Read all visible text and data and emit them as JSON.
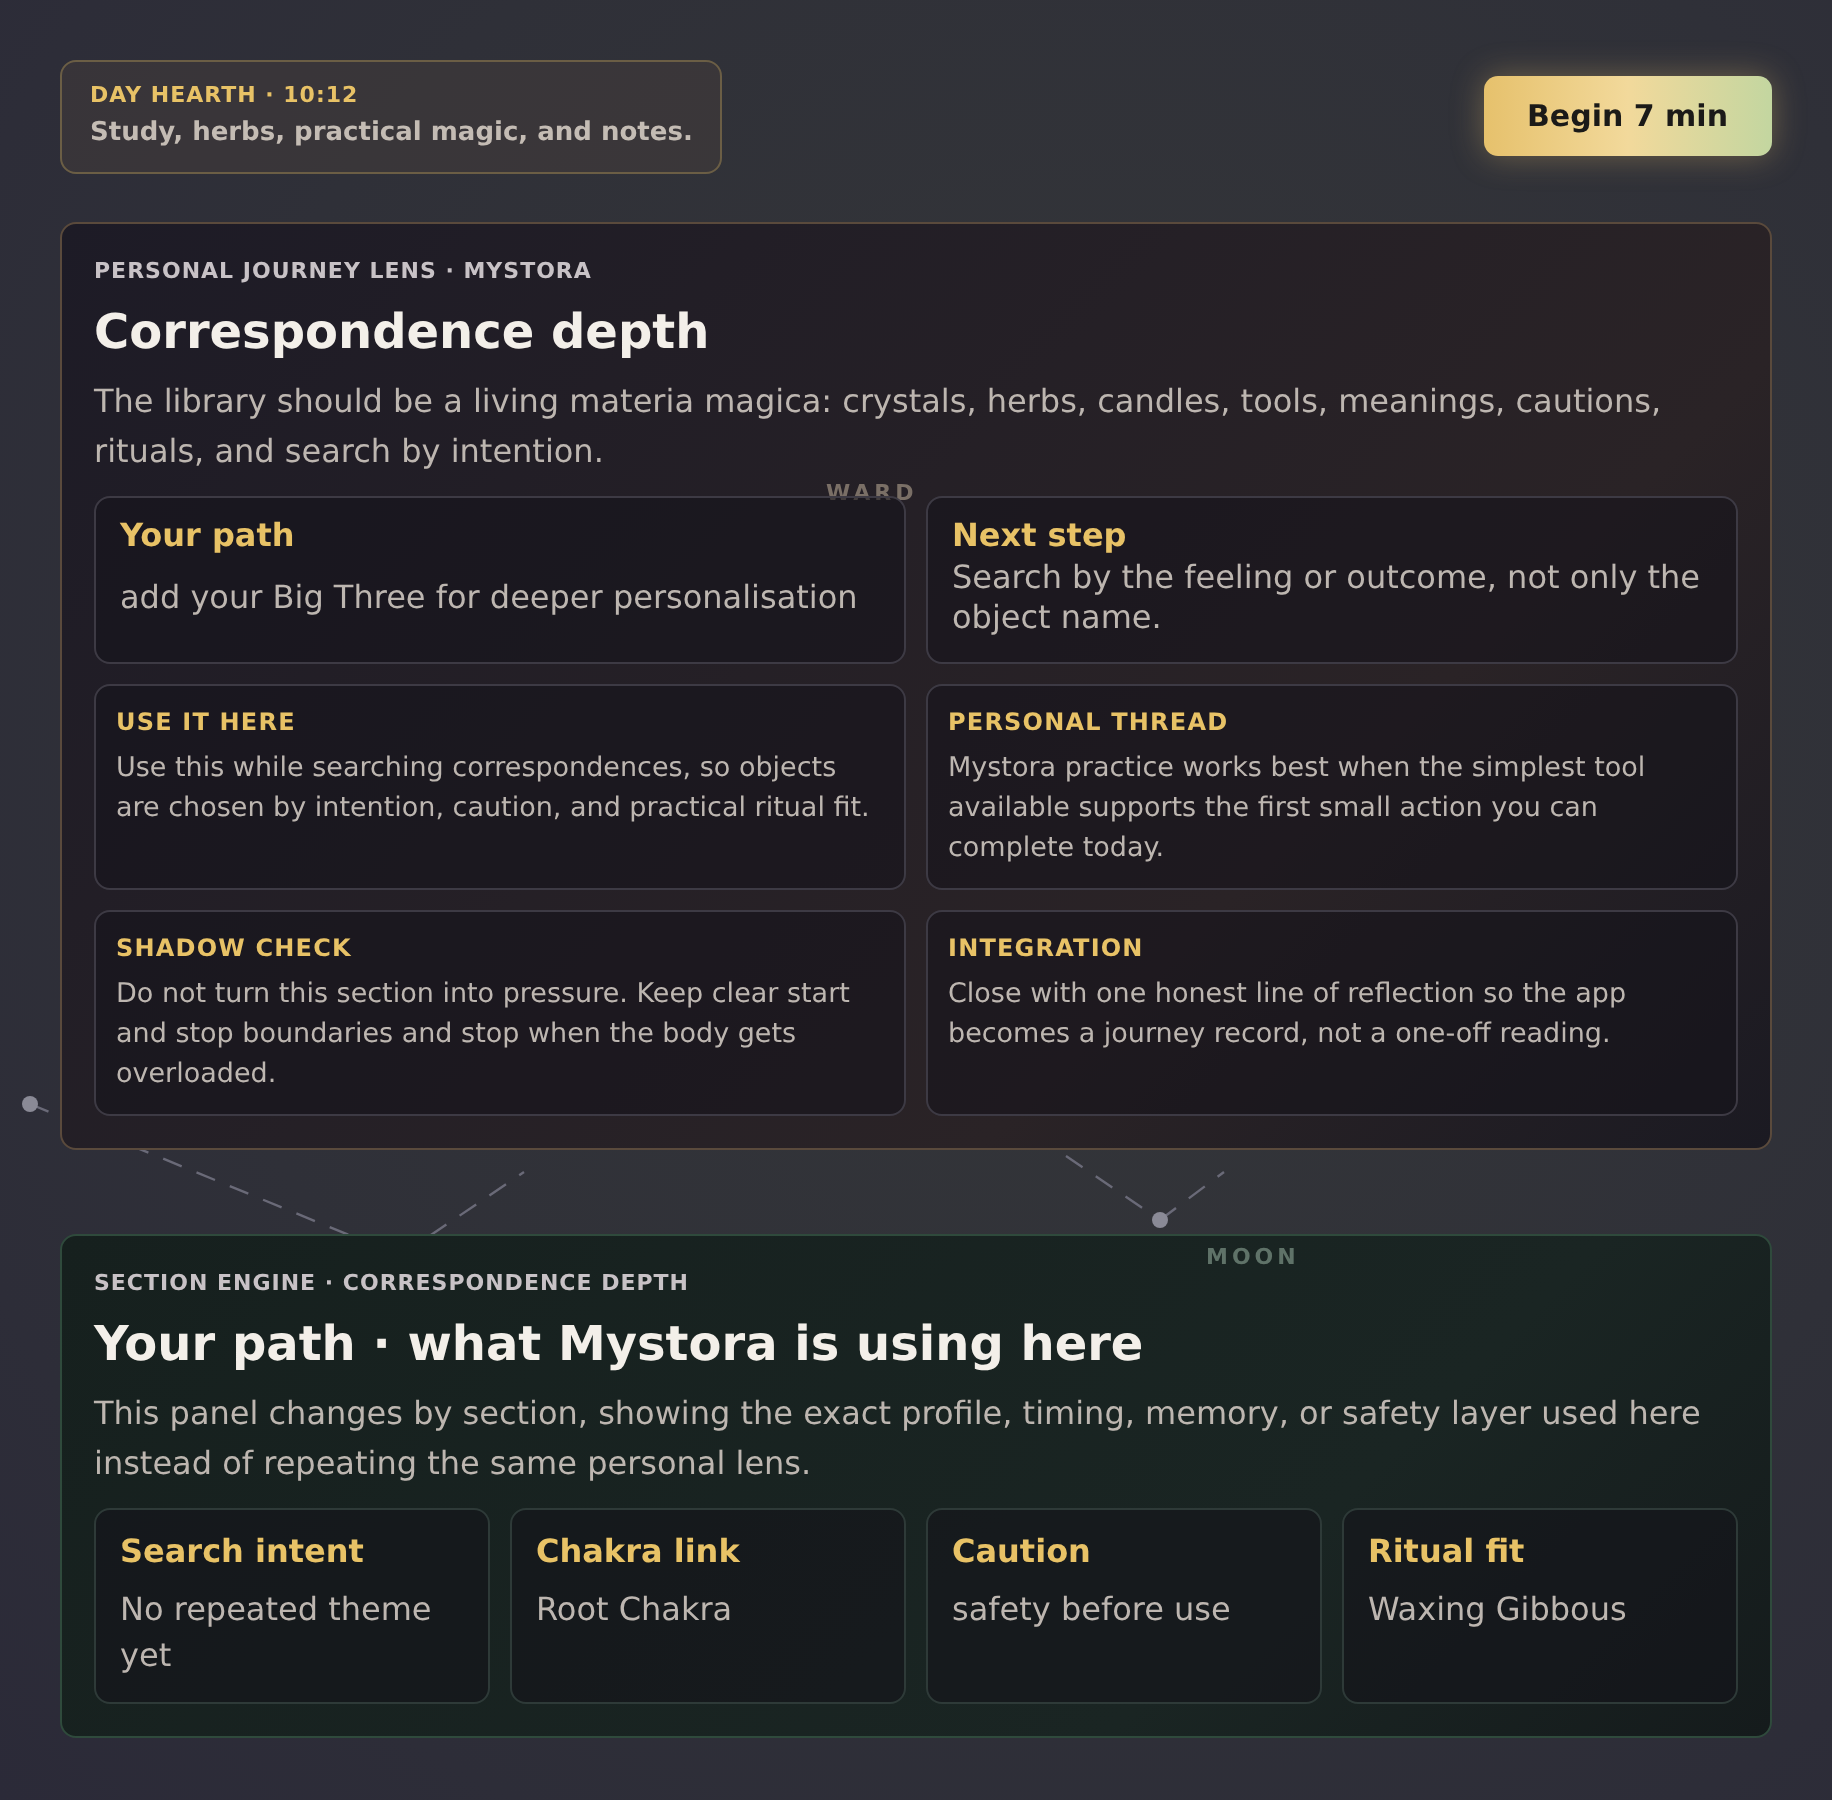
{
  "header": {
    "eyebrow": "DAY HEARTH · 10:12",
    "subtitle": "Study, herbs, practical magic, and notes.",
    "button": "Begin 7 min"
  },
  "background_labels": [
    "WARD",
    "MOON"
  ],
  "lens": {
    "eyebrow": "PERSONAL JOURNEY LENS · MYSTORA",
    "title": "Correspondence depth",
    "description": "The library should be a living materia magica: crystals, herbs, candles, tools, meanings, cautions, rituals, and search by intention.",
    "highlights": [
      {
        "title": "Your path",
        "text": "add your Big Three for deeper personalisation"
      },
      {
        "title": "Next step",
        "text": "Search by the feeling or outcome, not only the object name."
      }
    ],
    "notes": [
      {
        "title": "USE IT HERE",
        "text": "Use this while searching correspondences, so objects are chosen by intention, caution, and practical ritual fit."
      },
      {
        "title": "PERSONAL THREAD",
        "text": "Mystora practice works best when the simplest tool available supports the first small action you can complete today."
      },
      {
        "title": "SHADOW CHECK",
        "text": "Do not turn this section into pressure. Keep clear start and stop boundaries and stop when the body gets overloaded."
      },
      {
        "title": "INTEGRATION",
        "text": "Close with one honest line of reflection so the app becomes a journey record, not a one-off reading."
      }
    ]
  },
  "engine": {
    "eyebrow": "SECTION ENGINE · CORRESPONDENCE DEPTH",
    "title": "Your path · what Mystora is using here",
    "description": "This panel changes by section, showing the exact profile, timing, memory, or safety layer used here instead of repeating the same personal lens.",
    "cards": [
      {
        "title": "Search intent",
        "text": "No repeated theme yet"
      },
      {
        "title": "Chakra link",
        "text": "Root Chakra"
      },
      {
        "title": "Caution",
        "text": "safety before use"
      },
      {
        "title": "Ritual fit",
        "text": "Waxing Gibbous"
      }
    ]
  }
}
